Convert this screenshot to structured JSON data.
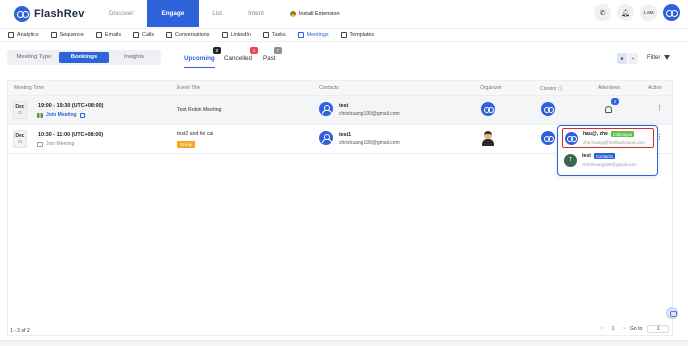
{
  "brand": {
    "name": "FlashRev",
    "color": "#2e62d9"
  },
  "topnav": {
    "items": [
      "Discover",
      "Engage",
      "List",
      "Intent"
    ],
    "active": "Engage",
    "extension_label": "Install Extension"
  },
  "topright": {
    "phone_icon": "phone-icon",
    "bell_icon": "bell-icon",
    "credits": "1.6M"
  },
  "subnav": {
    "items": [
      "Analytics",
      "Sequence",
      "Emails",
      "Calls",
      "Conversations",
      "LinkedIn",
      "Tasks",
      "Meetings",
      "Templates"
    ],
    "active": "Meetings"
  },
  "segments": {
    "items": [
      "Meeting Type",
      "Bookings",
      "Insights"
    ],
    "active": "Bookings"
  },
  "status_tabs": [
    {
      "label": "Upcoming",
      "count": "2",
      "color": "#222222"
    },
    {
      "label": "Cancelled",
      "count": "1",
      "color": "#e5484d"
    },
    {
      "label": "Past",
      "count": "7",
      "color": "#8a8f99"
    }
  ],
  "filter_label": "Filter",
  "table": {
    "headers": [
      "Meeting Time",
      "Event Title",
      "Contacts",
      "Organizer",
      "Creator",
      "Attendees",
      "Action"
    ],
    "rows": [
      {
        "month": "Dec",
        "day": "05",
        "time": "19:00 - 19:30 (UTC+08:00)",
        "join_label": "Join Meeting",
        "event": "Test Robin Meeting",
        "tag": "",
        "contact_name": "test",
        "contact_email": "chrishuang199@gmail.com",
        "attendee_count": "2"
      },
      {
        "month": "Dec",
        "day": "06",
        "time": "10:30 - 11:00 (UTC+08:00)",
        "join_label": "Join Meeting",
        "event": "test2 and fei cai",
        "tag": "Group",
        "contact_name": "test1",
        "contact_email": "chrishuang199@gmail.com"
      }
    ]
  },
  "popover": {
    "items": [
      {
        "name": "hau@, zhe",
        "tag": "Colleague",
        "email": "zhe.huang@meflashcloud.com"
      },
      {
        "avatar_letter": "T",
        "name": "test",
        "tag": "Contacts",
        "email": "chrishuang199@gmail.com"
      }
    ]
  },
  "pagination": {
    "summary": "1 - 2 of 2",
    "current_page": "1",
    "goto_label": "Go to",
    "goto_value": "1"
  }
}
